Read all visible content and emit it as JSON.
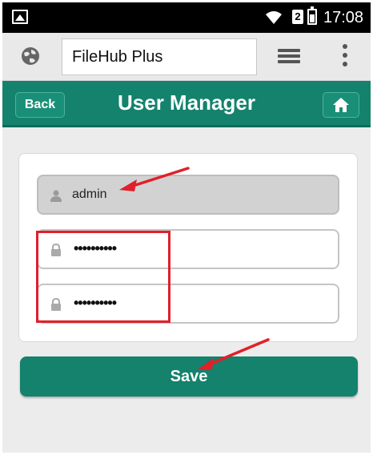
{
  "status_bar": {
    "time": "17:08",
    "sim_label": "2"
  },
  "browser": {
    "url_text": "FileHub Plus"
  },
  "header": {
    "back_label": "Back",
    "title": "User Manager"
  },
  "form": {
    "username_value": "admin",
    "password_value": "••••••••••",
    "confirm_password_value": "••••••••••"
  },
  "actions": {
    "save_label": "Save"
  },
  "colors": {
    "accent": "#14826d",
    "annotation": "#e0202a"
  }
}
